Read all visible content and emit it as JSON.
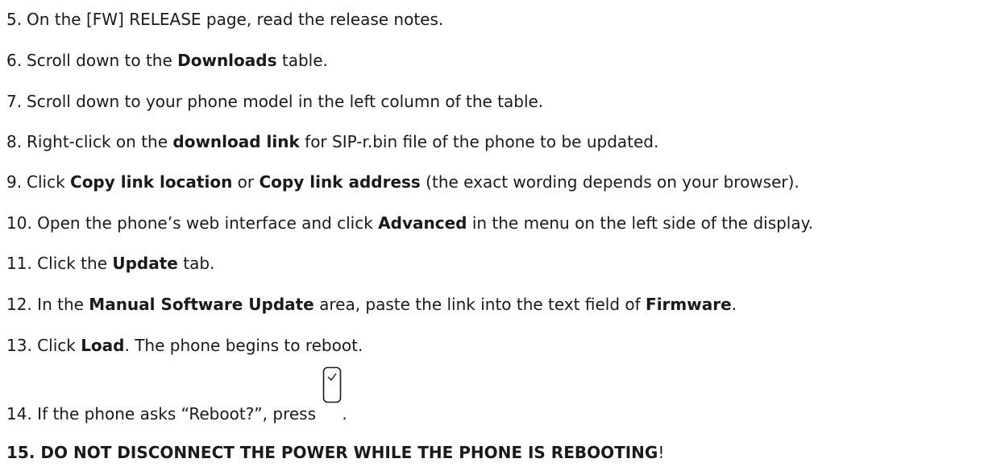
{
  "steps": [
    {
      "num": "5.",
      "segments": [
        {
          "t": "On the [FW] RELEASE page, read the release notes.",
          "b": false
        }
      ]
    },
    {
      "num": "6.",
      "segments": [
        {
          "t": "Scroll down to the ",
          "b": false
        },
        {
          "t": "Downloads",
          "b": true
        },
        {
          "t": " table.",
          "b": false
        }
      ]
    },
    {
      "num": "7.",
      "segments": [
        {
          "t": "Scroll down to your phone model in the left column of the table.",
          "b": false
        }
      ]
    },
    {
      "num": "8.",
      "segments": [
        {
          "t": "Right-click on the ",
          "b": false
        },
        {
          "t": "download link",
          "b": true
        },
        {
          "t": " for SIP-r.bin file of the phone to be updated.",
          "b": false
        }
      ]
    },
    {
      "num": "9.",
      "segments": [
        {
          "t": "Click ",
          "b": false
        },
        {
          "t": "Copy link location",
          "b": true
        },
        {
          "t": " or ",
          "b": false
        },
        {
          "t": "Copy link address",
          "b": true
        },
        {
          "t": " (the exact wording depends on your browser).",
          "b": false
        }
      ]
    },
    {
      "num": "10.",
      "segments": [
        {
          "t": "Open the phone’s web interface and click ",
          "b": false
        },
        {
          "t": "Advanced",
          "b": true
        },
        {
          "t": " in the menu on the left side of the display.",
          "b": false
        }
      ]
    },
    {
      "num": "11.",
      "segments": [
        {
          "t": "Click the ",
          "b": false
        },
        {
          "t": "Update",
          "b": true
        },
        {
          "t": " tab.",
          "b": false
        }
      ]
    },
    {
      "num": "12.",
      "segments": [
        {
          "t": "In the ",
          "b": false
        },
        {
          "t": "Manual Software Update",
          "b": true
        },
        {
          "t": " area, paste the link into the text field of ",
          "b": false
        },
        {
          "t": "Firmware",
          "b": true
        },
        {
          "t": ".",
          "b": false
        }
      ]
    },
    {
      "num": "13.",
      "segments": [
        {
          "t": "Click ",
          "b": false
        },
        {
          "t": "Load",
          "b": true
        },
        {
          "t": ".  The phone begins to reboot.",
          "b": false
        }
      ]
    },
    {
      "num": "14.",
      "segments": [
        {
          "t": "If the phone asks “Reboot?”, press ",
          "b": false
        }
      ],
      "icon": "checkmark-key-icon",
      "after": "."
    }
  ],
  "warning": {
    "bold": "15. DO NOT DISCONNECT THE POWER WHILE THE PHONE IS REBOOTING",
    "rest": "!"
  }
}
